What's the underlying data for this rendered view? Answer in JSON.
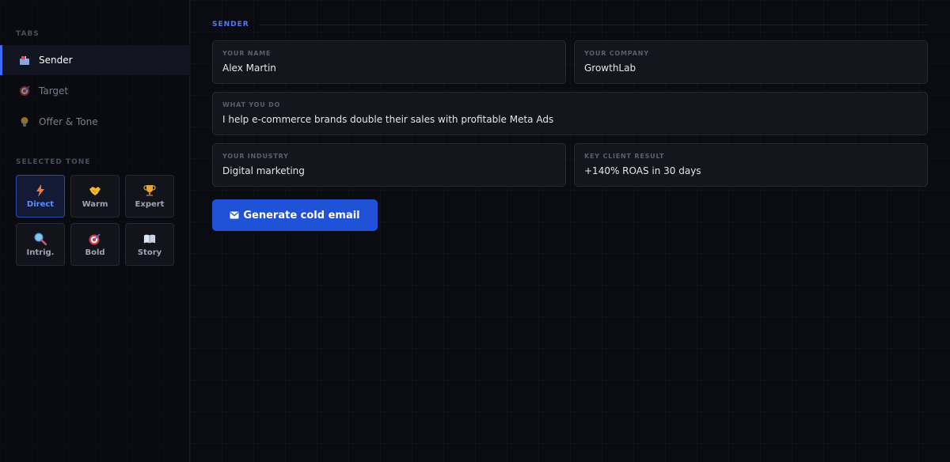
{
  "sidebar": {
    "tabs_label": "TABS",
    "tabs": [
      {
        "label": "Sender",
        "icon": "mailbox-icon",
        "active": true
      },
      {
        "label": "Target",
        "icon": "target-icon",
        "active": false
      },
      {
        "label": "Offer & Tone",
        "icon": "lightbulb-icon",
        "active": false
      }
    ],
    "tone_label": "SELECTED TONE",
    "tones": [
      {
        "label": "Direct",
        "icon": "lightning-icon",
        "active": true
      },
      {
        "label": "Warm",
        "icon": "handshake-icon",
        "active": false
      },
      {
        "label": "Expert",
        "icon": "trophy-icon",
        "active": false
      },
      {
        "label": "Intrig.",
        "icon": "magnifier-icon",
        "active": false
      },
      {
        "label": "Bold",
        "icon": "target-icon",
        "active": false
      },
      {
        "label": "Story",
        "icon": "book-icon",
        "active": false
      }
    ]
  },
  "main": {
    "section_label": "SENDER",
    "fields": {
      "name": {
        "label": "YOUR NAME",
        "value": "Alex Martin"
      },
      "company": {
        "label": "YOUR COMPANY",
        "value": "GrowthLab"
      },
      "what": {
        "label": "WHAT YOU DO",
        "value": "I help e-commerce brands double their sales with profitable Meta Ads"
      },
      "industry": {
        "label": "YOUR INDUSTRY",
        "value": "Digital marketing"
      },
      "result": {
        "label": "KEY CLIENT RESULT",
        "value": "+140% ROAS in 30 days"
      }
    },
    "generate_label": "Generate cold email"
  },
  "colors": {
    "accent": "#1f52d6",
    "background": "#0b0c12",
    "section_label": "#4f7bf0"
  }
}
